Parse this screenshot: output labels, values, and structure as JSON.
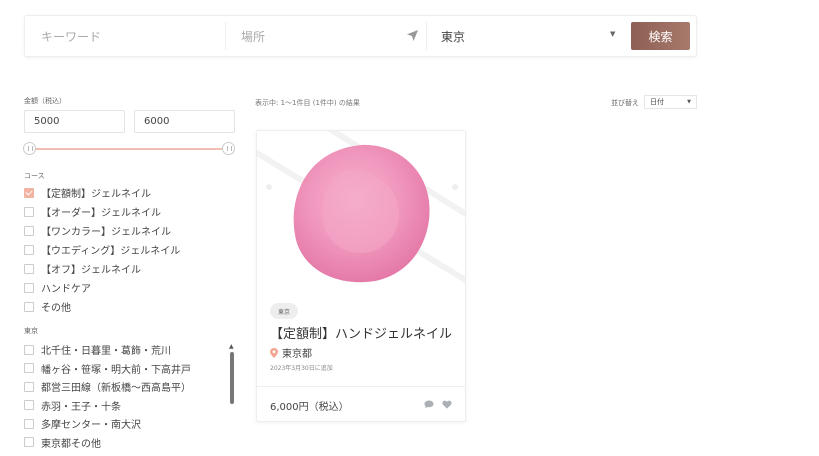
{
  "search": {
    "keyword_placeholder": "キーワード",
    "place_placeholder": "場所",
    "prefecture_value": "東京",
    "search_button": "検索"
  },
  "filters": {
    "price_label": "金額（税込）",
    "price_min": "5000",
    "price_max": "6000",
    "course_label": "コース",
    "courses": [
      {
        "label": "【定額制】ジェルネイル",
        "checked": true
      },
      {
        "label": "【オーダー】ジェルネイル",
        "checked": false
      },
      {
        "label": "【ワンカラー】ジェルネイル",
        "checked": false
      },
      {
        "label": "【ウエディング】ジェルネイル",
        "checked": false
      },
      {
        "label": "【オフ】ジェルネイル",
        "checked": false
      },
      {
        "label": "ハンドケア",
        "checked": false
      },
      {
        "label": "その他",
        "checked": false
      }
    ],
    "area_label": "東京",
    "areas": [
      {
        "label": "北千住・日暮里・葛飾・荒川",
        "checked": false
      },
      {
        "label": "幡ヶ谷・笹塚・明大前・下高井戸",
        "checked": false
      },
      {
        "label": "都営三田線（新板橋〜西高島平）",
        "checked": false
      },
      {
        "label": "赤羽・王子・十条",
        "checked": false
      },
      {
        "label": "多摩センター・南大沢",
        "checked": false
      },
      {
        "label": "東京都その他",
        "checked": false
      }
    ]
  },
  "results": {
    "count_text": "表示中: 1〜1件目 (1件中) の結果",
    "sort_label": "並び替え",
    "sort_value": "日付"
  },
  "card": {
    "badge": "東京",
    "title": "【定額制】ハンドジェルネイル",
    "location": "東京都",
    "date": "2023年3月30日に追加",
    "price": "6,000円（税込）"
  },
  "colors": {
    "accent": "#a0705f",
    "checkbox": "#f2b3a1",
    "slider": "#f0bfb2",
    "pin": "#f2a58f"
  }
}
